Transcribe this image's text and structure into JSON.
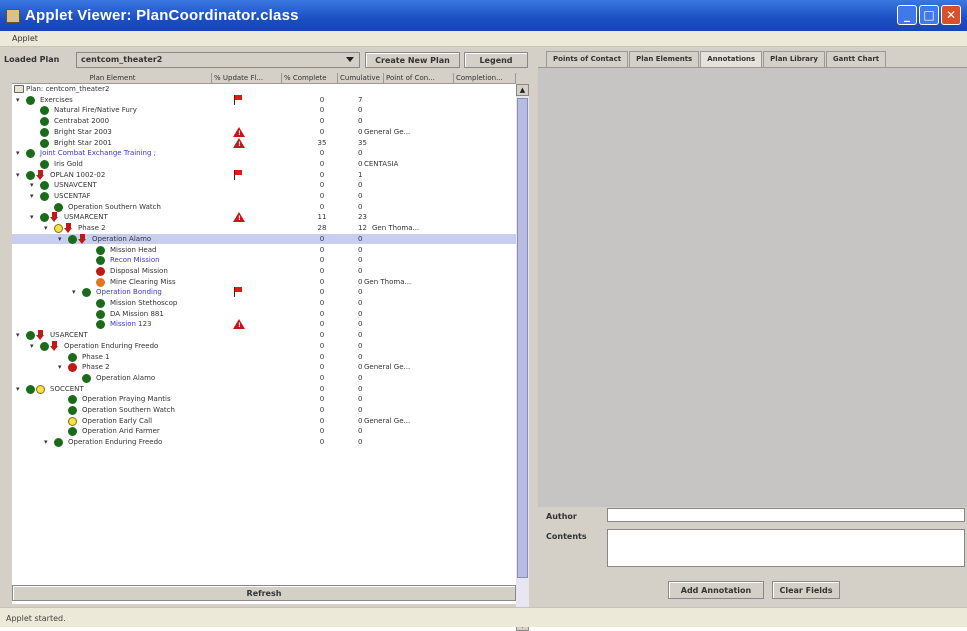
{
  "window": {
    "title": "Applet Viewer: PlanCoordinator.class"
  },
  "menu": {
    "applet": "Applet"
  },
  "plan": {
    "loaded_label": "Loaded Plan",
    "loaded_value": "centcom_theater2",
    "create_button": "Create New Plan",
    "legend_button": "Legend"
  },
  "columns": [
    "Plan Element",
    "% Update Fl...",
    "% Complete",
    "Cumulative ...",
    "Point of Con...",
    "Completion..."
  ],
  "tree": [
    {
      "label": "Plan: centcom_theater2",
      "pct": "",
      "cum": "",
      "poc": ""
    },
    {
      "label": "Exercises",
      "pct": "0",
      "cum": "7",
      "poc": ""
    },
    {
      "label": "Natural Fire/Native Fury",
      "pct": "0",
      "cum": "0",
      "poc": ""
    },
    {
      "label": "Centrabat 2000",
      "pct": "0",
      "cum": "0",
      "poc": ""
    },
    {
      "label": "Bright Star 2003",
      "pct": "0",
      "cum": "0",
      "poc": "General Ge..."
    },
    {
      "label": "Bright Star 2001",
      "pct": "35",
      "cum": "35",
      "poc": ""
    },
    {
      "label": "Joint Combat Exchange Training ;",
      "pct": "0",
      "cum": "0",
      "poc": ""
    },
    {
      "label": "Iris Gold",
      "pct": "0",
      "cum": "0",
      "poc": "CENTASIA"
    },
    {
      "label": "OPLAN 1002-02",
      "pct": "0",
      "cum": "1",
      "poc": ""
    },
    {
      "label": "USNAVCENT",
      "pct": "0",
      "cum": "0",
      "poc": ""
    },
    {
      "label": "USCENTAF",
      "pct": "0",
      "cum": "0",
      "poc": ""
    },
    {
      "label": "Operation Southern Watch",
      "pct": "0",
      "cum": "0",
      "poc": ""
    },
    {
      "label": "USMARCENT",
      "pct": "11",
      "cum": "23",
      "poc": ""
    },
    {
      "label": "Phase 2",
      "pct": "28",
      "cum": "12",
      "poc": "Gen Thoma..."
    },
    {
      "label": "Operation Alamo",
      "pct": "0",
      "cum": "0",
      "poc": ""
    },
    {
      "label": "Mission Head",
      "pct": "0",
      "cum": "0",
      "poc": ""
    },
    {
      "label": "Recon Mission",
      "pct": "0",
      "cum": "0",
      "poc": ""
    },
    {
      "label": "Disposal Mission",
      "pct": "0",
      "cum": "0",
      "poc": ""
    },
    {
      "label": "Mine Clearing Miss",
      "pct": "0",
      "cum": "0",
      "poc": "Gen Thoma..."
    },
    {
      "label": "Operation Bonding",
      "pct": "0",
      "cum": "0",
      "poc": ""
    },
    {
      "label": "Mission Stethoscop",
      "pct": "0",
      "cum": "0",
      "poc": ""
    },
    {
      "label": "DA Mission 881",
      "pct": "0",
      "cum": "0",
      "poc": ""
    },
    {
      "label": "Mission 123",
      "pct": "0",
      "cum": "0",
      "poc": ""
    },
    {
      "label": "USARCENT",
      "pct": "0",
      "cum": "0",
      "poc": ""
    },
    {
      "label": "Operation Enduring Freedo",
      "pct": "0",
      "cum": "0",
      "poc": ""
    },
    {
      "label": "Phase 1",
      "pct": "0",
      "cum": "0",
      "poc": ""
    },
    {
      "label": "Phase 2",
      "pct": "0",
      "cum": "0",
      "poc": "General Ge..."
    },
    {
      "label": "Operation Alamo",
      "pct": "0",
      "cum": "0",
      "poc": ""
    },
    {
      "label": "SOCCENT",
      "pct": "0",
      "cum": "0",
      "poc": ""
    },
    {
      "label": "Operation Praying Mantis",
      "pct": "0",
      "cum": "0",
      "poc": ""
    },
    {
      "label": "Operation Southern Watch",
      "pct": "0",
      "cum": "0",
      "poc": ""
    },
    {
      "label": "Operation Early Call",
      "pct": "0",
      "cum": "0",
      "poc": "General Ge..."
    },
    {
      "label": "Operation Arid Farmer",
      "pct": "0",
      "cum": "0",
      "poc": ""
    },
    {
      "label": "Operation Enduring Freedo",
      "pct": "0",
      "cum": "0",
      "poc": ""
    }
  ],
  "refresh_button": "Refresh",
  "tabs": [
    "Points of Contact",
    "Plan Elements",
    "Annotations",
    "Plan Library",
    "Gantt Chart"
  ],
  "form": {
    "author_label": "Author",
    "contents_label": "Contents",
    "author_value": "",
    "contents_value": "",
    "add_button": "Add Annotation",
    "clear_button": "Clear Fields"
  },
  "status": "Applet started."
}
